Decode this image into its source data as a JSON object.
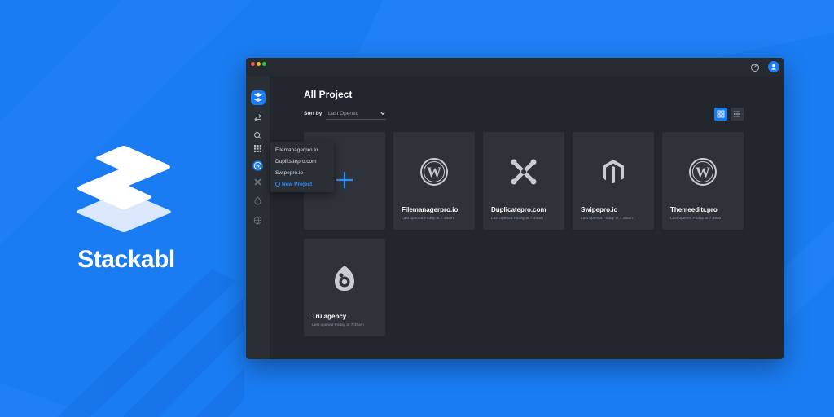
{
  "brand": {
    "name": "Stackabl"
  },
  "window": {
    "title_dots": [
      "red",
      "yellow",
      "green"
    ],
    "help_icon": "question-circle-icon",
    "help_glyph": "?",
    "avatar_icon": "user-icon"
  },
  "sidebar": {
    "items": [
      {
        "icon": "stackabl-logo-icon"
      },
      {
        "icon": "transfer-arrows-icon"
      },
      {
        "icon": "search-icon"
      },
      {
        "icon": "apps-grid-icon"
      },
      {
        "icon": "wordpress-icon"
      },
      {
        "icon": "joomla-icon"
      },
      {
        "icon": "drupal-icon"
      },
      {
        "icon": "globe-icon"
      }
    ]
  },
  "popup": {
    "items": [
      "Filemanagerpro.io",
      "Duplicatepro.com",
      "Swipepro.io"
    ],
    "new_project_label": "New Project"
  },
  "main": {
    "title": "All Project",
    "sort_label": "Sort by",
    "sort_value": "Last Opened",
    "view_modes": [
      {
        "icon": "grid-view-icon",
        "active": true
      },
      {
        "icon": "list-view-icon",
        "active": false
      }
    ],
    "add_card_icon": "plus-icon",
    "projects": [
      {
        "name": "Filemanagerpro.io",
        "last_opened": "Last opened Friday at 7:49am",
        "icon": "wordpress-icon"
      },
      {
        "name": "Duplicatepro.com",
        "last_opened": "Last opened Friday at 7:49am",
        "icon": "joomla-icon"
      },
      {
        "name": "Swipepro.io",
        "last_opened": "Last opened Friday at 7:49am",
        "icon": "magento-icon"
      },
      {
        "name": "Themeeditr.pro",
        "last_opened": "Last opened Friday at 7:49am",
        "icon": "wordpress-icon"
      },
      {
        "name": "Tru.agency",
        "last_opened": "Last opened Friday at 7:49am",
        "icon": "drupal-icon"
      }
    ]
  },
  "colors": {
    "background": "#1a7cf2",
    "window": "#22262d",
    "card": "#2e3239",
    "accent": "#1a7cf2"
  }
}
